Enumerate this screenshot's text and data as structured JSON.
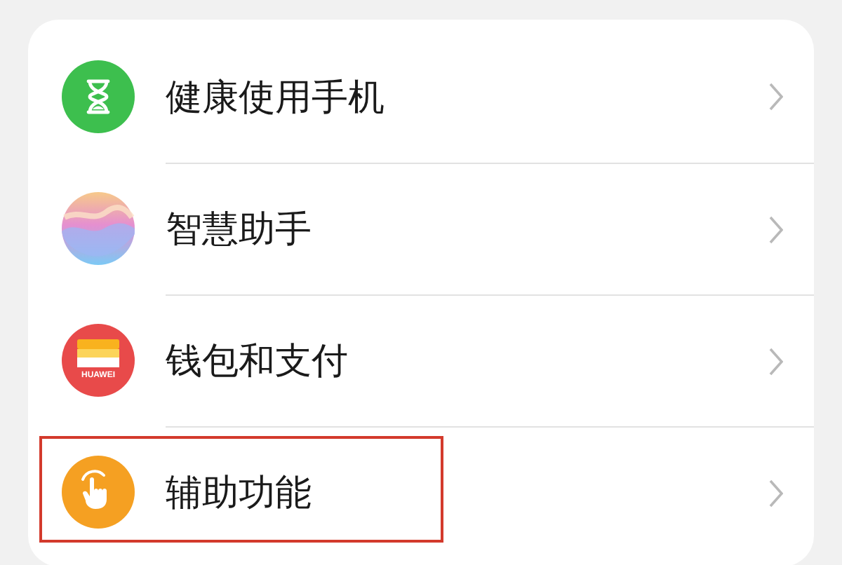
{
  "items": [
    {
      "kind": "hourglass",
      "label": "健康使用手机",
      "highlighted": false
    },
    {
      "kind": "orb",
      "label": "智慧助手",
      "highlighted": false
    },
    {
      "kind": "wallet",
      "label": "钱包和支付",
      "icon_text": "HUAWEI",
      "highlighted": false
    },
    {
      "kind": "hand",
      "label": "辅助功能",
      "highlighted": true
    }
  ]
}
